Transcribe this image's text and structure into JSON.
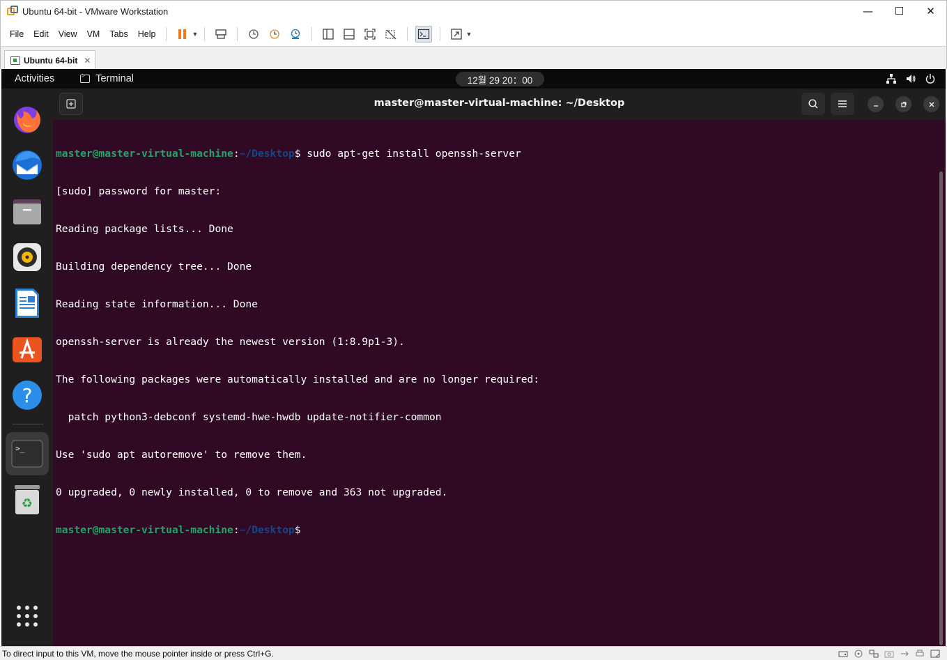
{
  "window": {
    "title": "Ubuntu 64-bit - VMware Workstation",
    "minimize": "—",
    "maximize": "☐",
    "close": "✕"
  },
  "menu": [
    "File",
    "Edit",
    "View",
    "VM",
    "Tabs",
    "Help"
  ],
  "tab": {
    "label": "Ubuntu 64-bit",
    "close": "✕"
  },
  "ubuntu": {
    "activities": "Activities",
    "app_name": "Terminal",
    "clock": "12월 29  20：00"
  },
  "terminal": {
    "title": "master@master-virtual-machine: ~/Desktop",
    "prompt_user": "master@master-virtual-machine",
    "prompt_sep": ":",
    "prompt_path": "~/Desktop",
    "prompt_end": "$",
    "command": " sudo apt-get install openssh-server",
    "output": [
      "[sudo] password for master:",
      "Reading package lists... Done",
      "Building dependency tree... Done",
      "Reading state information... Done",
      "openssh-server is already the newest version (1:8.9p1-3).",
      "The following packages were automatically installed and are no longer required:",
      "  patch python3-debconf systemd-hwe-hwdb update-notifier-common",
      "Use 'sudo apt autoremove' to remove them.",
      "0 upgraded, 0 newly installed, 0 to remove and 363 not upgraded."
    ]
  },
  "dock": [
    "firefox-icon",
    "thunderbird-icon",
    "files-icon",
    "rhythmbox-icon",
    "libreoffice-writer-icon",
    "app-center-icon",
    "help-icon",
    "terminal-icon",
    "trash-icon",
    "show-apps-icon"
  ],
  "status": {
    "text": "To direct input to this VM, move the mouse pointer inside or press Ctrl+G."
  },
  "colors": {
    "terminal_bg": "#300a24",
    "prompt_user": "#26a269",
    "prompt_path": "#12488b",
    "accent": "#e95420"
  }
}
